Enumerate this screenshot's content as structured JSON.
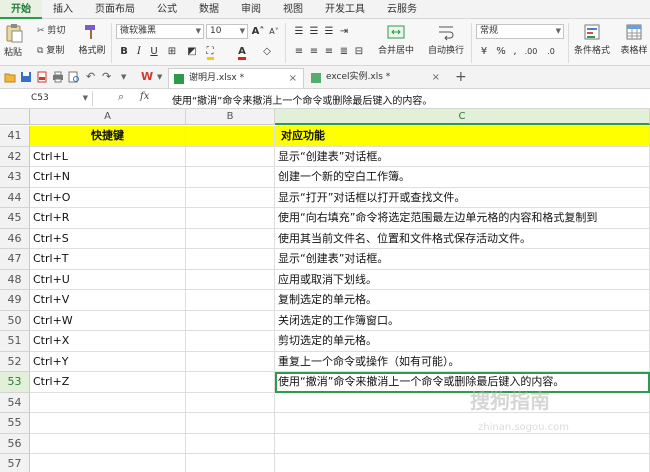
{
  "menu": {
    "tabs": [
      "开始",
      "插入",
      "页面布局",
      "公式",
      "数据",
      "审阅",
      "视图",
      "开发工具",
      "云服务"
    ],
    "active": "开始"
  },
  "ribbon": {
    "paste": "粘贴",
    "cut": "剪切",
    "copy": "复制",
    "format_painter": "格式刷",
    "font_name": "微软雅黑",
    "font_size": "10",
    "merge_center": "合并居中",
    "wrap_text": "自动换行",
    "number_format": "常规",
    "conditional_format": "条件格式",
    "table_style": "表格样"
  },
  "documents": {
    "tabs": [
      {
        "name": "谢明月.xlsx *",
        "active": true
      },
      {
        "name": "excel实例.xls *",
        "active": false
      }
    ],
    "new_tab": "+"
  },
  "formula_bar": {
    "cell_ref": "C53",
    "fx": "fx",
    "content": "使用“撤消”命令来撤消上一个命令或删除最后键入的内容。"
  },
  "columns": [
    "A",
    "B",
    "C"
  ],
  "selected_column": "C",
  "rows": [
    {
      "num": "41",
      "a": "快捷键",
      "b": "",
      "c": "对应功能",
      "header": true
    },
    {
      "num": "42",
      "a": "Ctrl+L",
      "b": "",
      "c": "显示“创建表”对话框。"
    },
    {
      "num": "43",
      "a": "Ctrl+N",
      "b": "",
      "c": "创建一个新的空白工作簿。"
    },
    {
      "num": "44",
      "a": "Ctrl+O",
      "b": "",
      "c": "显示“打开”对话框以打开或查找文件。"
    },
    {
      "num": "45",
      "a": "Ctrl+R",
      "b": "",
      "c": "使用“向右填充”命令将选定范围最左边单元格的内容和格式复制到"
    },
    {
      "num": "46",
      "a": "Ctrl+S",
      "b": "",
      "c": "使用其当前文件名、位置和文件格式保存活动文件。"
    },
    {
      "num": "47",
      "a": "Ctrl+T",
      "b": "",
      "c": "显示“创建表”对话框。"
    },
    {
      "num": "48",
      "a": "Ctrl+U",
      "b": "",
      "c": "应用或取消下划线。"
    },
    {
      "num": "49",
      "a": "Ctrl+V",
      "b": "",
      "c": "复制选定的单元格。"
    },
    {
      "num": "50",
      "a": "Ctrl+W",
      "b": "",
      "c": "关闭选定的工作簿窗口。"
    },
    {
      "num": "51",
      "a": "Ctrl+X",
      "b": "",
      "c": "剪切选定的单元格。"
    },
    {
      "num": "52",
      "a": "Ctrl+Y",
      "b": "",
      "c": "重复上一个命令或操作（如有可能）。"
    },
    {
      "num": "53",
      "a": "Ctrl+Z",
      "b": "",
      "c": "使用“撤消”命令来撤消上一个命令或删除最后键入的内容。",
      "selected": true
    },
    {
      "num": "54",
      "a": "",
      "b": "",
      "c": ""
    },
    {
      "num": "55",
      "a": "",
      "b": "",
      "c": ""
    },
    {
      "num": "56",
      "a": "",
      "b": "",
      "c": ""
    },
    {
      "num": "57",
      "a": "",
      "b": "",
      "c": ""
    }
  ],
  "watermark": {
    "text": "搜狗指南",
    "url": "zhinan.sogou.com"
  },
  "colors": {
    "accent": "#2d9b4b",
    "header_fill": "#ffff00"
  }
}
